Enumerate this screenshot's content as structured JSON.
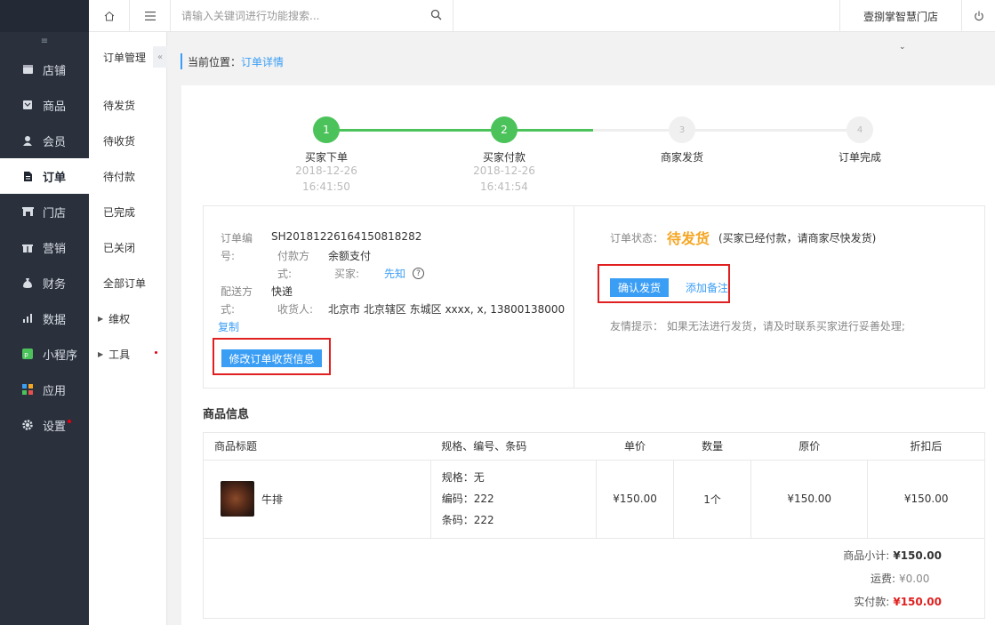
{
  "sidebar": {
    "collapse_glyph": "≡",
    "items": [
      {
        "label": "店铺",
        "icon": "shop-icon"
      },
      {
        "label": "商品",
        "icon": "goods-icon"
      },
      {
        "label": "会员",
        "icon": "member-icon"
      },
      {
        "label": "订单",
        "icon": "order-icon",
        "active": true
      },
      {
        "label": "门店",
        "icon": "store-icon"
      },
      {
        "label": "营销",
        "icon": "gift-icon"
      },
      {
        "label": "财务",
        "icon": "finance-icon"
      },
      {
        "label": "数据",
        "icon": "chart-icon"
      },
      {
        "label": "小程序",
        "icon": "miniprogram-icon"
      },
      {
        "label": "应用",
        "icon": "apps-icon"
      },
      {
        "label": "设置",
        "icon": "gear-icon",
        "dot": true
      }
    ]
  },
  "topbar": {
    "search_placeholder": "请输入关键词进行功能搜索...",
    "store_name": "壹捌掌智慧门店"
  },
  "subnav": {
    "title": "订单管理",
    "toggle": "«",
    "items": [
      "待发货",
      "待收货",
      "待付款",
      "已完成",
      "已关闭",
      "全部订单"
    ],
    "groups": [
      "维权",
      "工具"
    ]
  },
  "breadcrumb": {
    "prefix": "当前位置：",
    "current": "订单详情"
  },
  "steps": [
    {
      "num": "1",
      "label": "买家下单",
      "date": "2018-12-26",
      "time": "16:41:50",
      "done": true
    },
    {
      "num": "2",
      "label": "买家付款",
      "date": "2018-12-26",
      "time": "16:41:54",
      "done": true
    },
    {
      "num": "3",
      "label": "商家发货",
      "date": "",
      "time": "",
      "done": false
    },
    {
      "num": "4",
      "label": "订单完成",
      "date": "",
      "time": "",
      "done": false
    }
  ],
  "order_info": {
    "order_no_label_1": "订单编",
    "order_no_label_2": "号:",
    "order_no": "SH20181226164150818282",
    "pay_label_1": "付款方",
    "pay_label_2": "式:",
    "pay_method": "余额支付",
    "buyer_label": "买家:",
    "buyer": "先知",
    "ship_label_1": "配送方",
    "ship_label_2": "式:",
    "ship_method": "快递",
    "receiver_label": "收货人:",
    "receiver": "北京市 北京辖区 东城区 xxxx, x, 13800138000",
    "copy": "复制",
    "modify_button": "修改订单收货信息"
  },
  "order_status": {
    "label": "订单状态：",
    "status": "待发货",
    "note": "(买家已经付款，请商家尽快发货)",
    "confirm_button": "确认发货",
    "add_remark": "添加备注",
    "tip": "友情提示：  如果无法进行发货，请及时联系买家进行妥善处理;"
  },
  "goods": {
    "section_title": "商品信息",
    "headers": [
      "商品标题",
      "规格、编号、条码",
      "单价",
      "数量",
      "原价",
      "折扣后"
    ],
    "rows": [
      {
        "title": "牛排",
        "spec": "规格：无",
        "code": "编码：222",
        "barcode": "条码：222",
        "price": "¥150.00",
        "qty": "1个",
        "original": "¥150.00",
        "discount": "¥150.00"
      }
    ]
  },
  "summary": {
    "subtotal_label": "商品小计:",
    "subtotal": "¥150.00",
    "shipping_label": "运费:",
    "shipping": "¥0.00",
    "paid_label": "实付款:",
    "paid": "¥150.00"
  },
  "colors": {
    "accent": "#3b9ef5",
    "success": "#4cc35a",
    "warning": "#f5a623",
    "danger": "#e02020",
    "sidebar": "#2a313d"
  }
}
